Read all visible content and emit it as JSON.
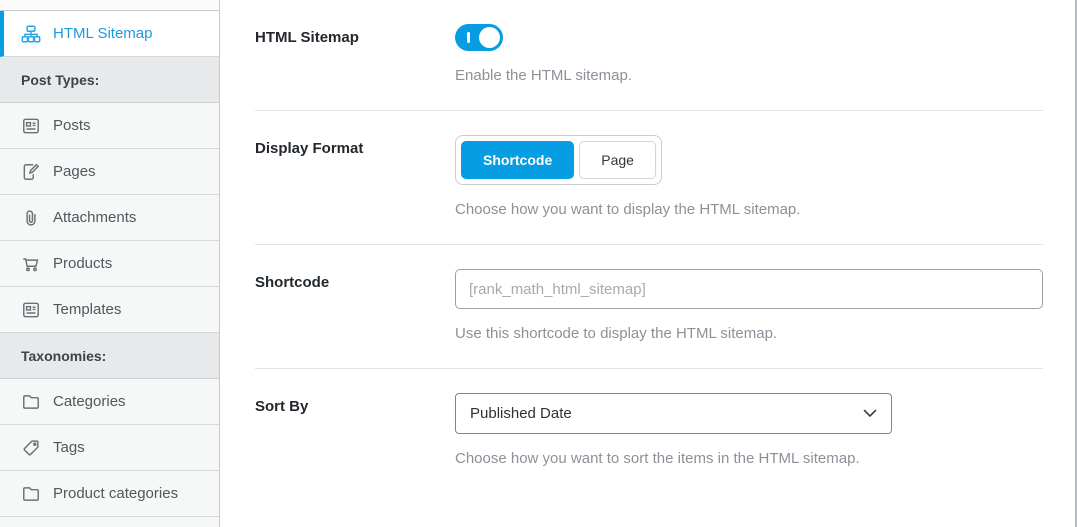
{
  "colors": {
    "accent": "#069de3",
    "sidebar_header_bg": "#e8e9eb",
    "sidebar_item_bg": "#f6f7f7"
  },
  "sidebar": {
    "items": [
      {
        "label": "HTML Sitemap",
        "icon": "sitemap-icon",
        "type": "item",
        "active": true
      },
      {
        "label": "Post Types:",
        "type": "section-header"
      },
      {
        "label": "Posts",
        "icon": "posts-icon",
        "type": "item"
      },
      {
        "label": "Pages",
        "icon": "pages-icon",
        "type": "item"
      },
      {
        "label": "Attachments",
        "icon": "paperclip-icon",
        "type": "item"
      },
      {
        "label": "Products",
        "icon": "cart-icon",
        "type": "item"
      },
      {
        "label": "Templates",
        "icon": "templates-icon",
        "type": "item"
      },
      {
        "label": "Taxonomies:",
        "type": "section-header"
      },
      {
        "label": "Categories",
        "icon": "folder-icon",
        "type": "item"
      },
      {
        "label": "Tags",
        "icon": "tag-icon",
        "type": "item"
      },
      {
        "label": "Product categories",
        "icon": "folder-icon",
        "type": "item"
      }
    ]
  },
  "settings": [
    {
      "label": "HTML Sitemap",
      "control": "toggle",
      "toggle_on": true,
      "description": "Enable the HTML sitemap."
    },
    {
      "label": "Display Format",
      "control": "button-group",
      "options": [
        "Shortcode",
        "Page"
      ],
      "selected": "Shortcode",
      "description": "Choose how you want to display the HTML sitemap."
    },
    {
      "label": "Shortcode",
      "control": "text-input",
      "value": "",
      "placeholder": "[rank_math_html_sitemap]",
      "description": "Use this shortcode to display the HTML sitemap."
    },
    {
      "label": "Sort By",
      "control": "select",
      "value": "Published Date",
      "description": "Choose how you want to sort the items in the HTML sitemap."
    }
  ]
}
